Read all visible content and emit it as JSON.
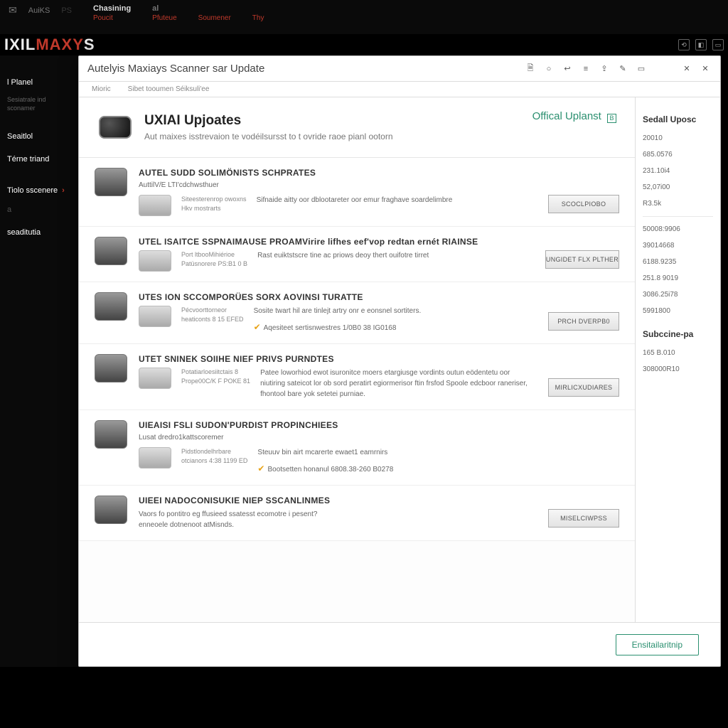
{
  "topbar": {
    "brand": "AuiKS",
    "t1": "PS",
    "c1": "Chasining",
    "c2": "al",
    "n1": "Poucit",
    "n2": "Pfuteue",
    "n3": "Soumener",
    "n4": "Thy"
  },
  "logo": {
    "p1": "IXIL",
    "p2": "MAXY",
    "p3": "S"
  },
  "sidebar": {
    "items": [
      {
        "label": "l Planel"
      },
      {
        "label": "Sesiatrale ind sconamer"
      },
      {
        "label": "Seaitlol"
      },
      {
        "label": "Térne triand"
      },
      {
        "label": "Tiolo sscenere"
      },
      {
        "label": "a"
      },
      {
        "label": "seaditutia"
      }
    ]
  },
  "dialog": {
    "title": "Autelyis Maxiays Scanner sar Update",
    "sub1": "Mioric",
    "sub2": "Sibet tooumen Séiksuli'ee",
    "hero": {
      "title": "UXIAI Upjoates",
      "sub": "Aut maixes isstrevaion te vodéilsursst to t ovride raoe pianl ootorn",
      "badge": "Offical Uplanst",
      "badge_sym": "B"
    },
    "rows": [
      {
        "title": "AUTEL SUDD SOLIMÖNISTS SCHPRATES",
        "d1": "AuttilV/E LTI'cdchwsthuer",
        "mt": "Siteesterenrop owoxns\nHkv mostrarts",
        "desc": "Sifnaide aitty oor dblootareter oor emur fraghave soardelimbre",
        "btn": "SCOCLPIOBO"
      },
      {
        "title": "UTEL ISAITCE SSPNAIMAUSE PROAMVirire lifhes eef'vop redtan ernét RIAINSE",
        "d1": "",
        "mt": "Port ltbooMihiérioe\nPatüsnorere PS:B1 0 B",
        "desc": "Rast euiktstscre tine ac priows deoy thert ouifotre tirret",
        "btn": "UNGIDET FLX PLTHER"
      },
      {
        "title": "UTES ION SCCOMPORÜES SORX AOVINSI TURATTE",
        "d1": "",
        "mt": "Pécvoorttorneor\nheaticonts 8 15 EFED",
        "desc": "Sosite twart hil are tinlejt artry onr e eonsnel sortiters.",
        "extra": "Aqesiteet sertisnwestres 1/0B0 38 IG0168",
        "chk": true,
        "btn": "PRCH DVERPB0"
      },
      {
        "title": "UTET SNINEK SOIIHE NIEF PRIVS PURNDTES",
        "d1": "",
        "mt": "Potatiarloesiitctais 8\nPrope00C/K F POKE 81",
        "desc": "Patee loworhiod ewot isuronitce moers etargiusge vordints outun eödentetu oor niutiring sateicot lor ob sord peratirt egiormerisor ftin frsfod Spoole edcboor raneriser, fhontool bare yok setetei purniae.",
        "btn": "MIRLICXUDIARES"
      },
      {
        "title": "UIEAISI FSLI SUDON'PURDIST PROPINCHIEES",
        "d1": "Lusat dredro1kattscoremer",
        "mt": "Pidstlondelhrbare\notcianors 4:38 1199 ED",
        "desc": "Steuuv bin airt mcarerte ewaet1 eamrnirs",
        "extra": "Bootsetten honanul 6808.38-260 B0278",
        "chk": true,
        "btn": ""
      },
      {
        "title": "UIEEI NADOCONISUKIE NIEP SSCANLINMES",
        "d1": "",
        "mt": "",
        "desc": "Vaors fo pontitro eg ffusieed ssatesst ecomotre i pesent?\nenneoele dotnenoot atMisnds.",
        "btn": "MISELCIWPSS"
      }
    ],
    "footer_btn": "Ensitailaritnip"
  },
  "sidepanel": {
    "title": "Sedall Uposc",
    "vals": [
      "20010",
      "685.0576",
      "231.10i4",
      "52,07i00",
      "R3.5k",
      "50008:9906",
      "39014668",
      "6188.9235",
      "251.8 9019",
      "3086.25i78",
      "5991800"
    ],
    "title2": "Subccine-pa",
    "vals2": [
      "165 B.010",
      "308000R10"
    ]
  }
}
